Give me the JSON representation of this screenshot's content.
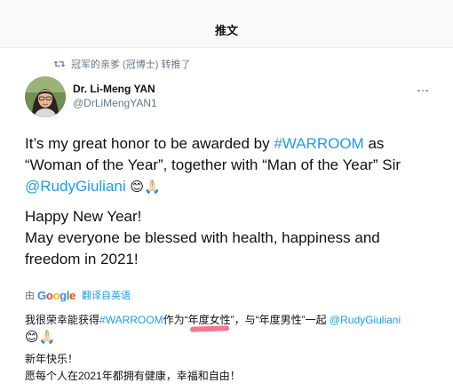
{
  "header": {
    "title": "推文"
  },
  "retweet": {
    "text": "冠军的亲爹 (冠博士) 转推了"
  },
  "author": {
    "name": "Dr. Li-Meng YAN",
    "handle": "@DrLiMengYAN1"
  },
  "tweet": {
    "p1_a": "It’s my great honor to be awarded by ",
    "hashtag": "#WARROOM",
    "p1_b": " as “Woman of the Year”, together with “Man of the Year” Sir ",
    "mention": "@RudyGiuliani",
    "emoji": "😊🙏🏻",
    "p2_line1": "Happy New Year!",
    "p2_line2": "May everyone be blessed with health, happiness and freedom in 2021!"
  },
  "translation": {
    "by": "由",
    "provider": "Google",
    "link": "翻译自英语"
  },
  "chinese": {
    "p1_a": "我很荣幸能获得",
    "hashtag": "#WARROOM",
    "p1_b": "作为“",
    "highlight": "年度女性",
    "p1_c": "”，与“年度男性”一起 ",
    "mention": "@RudyGiuliani",
    "emoji": "😊🙏🏻",
    "line2": "新年快乐！",
    "line3": "愿每个人在2021年都拥有健康，幸福和自由！"
  },
  "colors": {
    "link": "#1d9bf0",
    "highlight": "#f0607a",
    "secondary": "#657786"
  }
}
